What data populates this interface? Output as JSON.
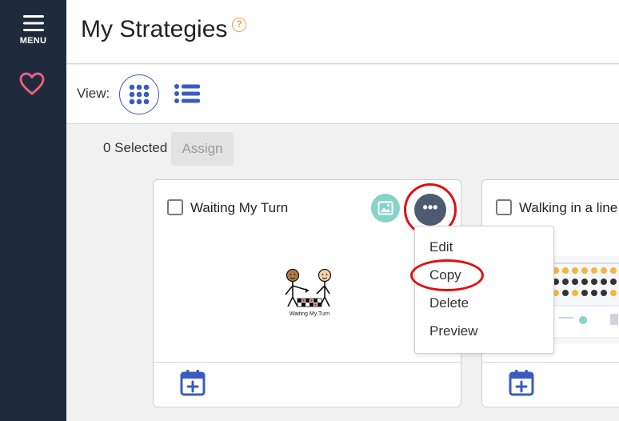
{
  "sidebar": {
    "menu_label": "MENU",
    "favorites_icon": "heart-icon"
  },
  "header": {
    "title": "My Strategies",
    "help_symbol": "?"
  },
  "view": {
    "label": "View:",
    "options": [
      "grid-view",
      "list-view"
    ],
    "active": "grid-view"
  },
  "selection": {
    "count_text": "0 Selected",
    "assign_label": "Assign"
  },
  "cards": [
    {
      "title": "Waiting My Turn",
      "checked": false,
      "illustration_caption": "Waiting My Turn"
    },
    {
      "title": "Walking in a line",
      "checked": false
    }
  ],
  "dropdown": {
    "items": [
      {
        "label": "Edit"
      },
      {
        "label": "Copy"
      },
      {
        "label": "Delete"
      },
      {
        "label": "Preview"
      }
    ]
  },
  "more_button_symbol": "•••",
  "colors": {
    "sidebar_bg": "#1f2a3d",
    "accent_blue": "#3a5bbf",
    "heart_pink": "#e8617a",
    "image_badge": "#86d3c8",
    "more_button": "#4d5b70",
    "annotation_red": "#e01010",
    "help_orange": "#f0a04b"
  }
}
